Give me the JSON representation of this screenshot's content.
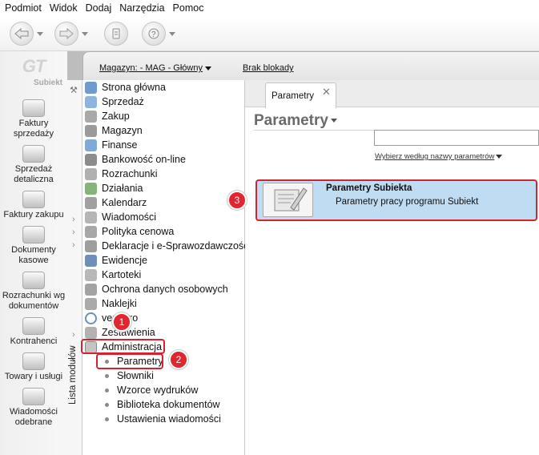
{
  "menu": [
    "Podmiot",
    "Widok",
    "Dodaj",
    "Narzędzia",
    "Pomoc"
  ],
  "toolbar": {
    "buttons": [
      "back-icon",
      "forward-icon",
      "module-icon",
      "help-icon"
    ]
  },
  "logo": {
    "mark": "GT",
    "text": "Subiekt"
  },
  "left_nav": [
    {
      "label": "Faktury sprzedaży",
      "icon": "invoice-icon"
    },
    {
      "label": "Sprzedaż detaliczna",
      "icon": "cash-register-icon"
    },
    {
      "label": "Faktury zakupu",
      "icon": "purchase-invoice-icon"
    },
    {
      "label": "Dokumenty kasowe",
      "icon": "cash-documents-icon"
    },
    {
      "label": "Rozrachunki wg dokumentów",
      "icon": "settlements-icon"
    },
    {
      "label": "Kontrahenci",
      "icon": "contractors-icon"
    },
    {
      "label": "Towary i usługi",
      "icon": "goods-icon"
    },
    {
      "label": "Wiadomości odebrane",
      "icon": "messages-icon"
    }
  ],
  "topbar": {
    "magazyn": "Magazyn: - MAG - Główny",
    "blokada": "Brak blokady"
  },
  "module_list_label": "Lista modułów",
  "tree": [
    {
      "label": "Strona główna",
      "icon": "home-icon"
    },
    {
      "label": "Sprzedaż",
      "icon": "sales-icon"
    },
    {
      "label": "Zakup",
      "icon": "purchase-icon"
    },
    {
      "label": "Magazyn",
      "icon": "warehouse-icon"
    },
    {
      "label": "Finanse",
      "icon": "finance-icon"
    },
    {
      "label": "Bankowość on-line",
      "icon": "bank-icon"
    },
    {
      "label": "Rozrachunki",
      "icon": "settlement-icon"
    },
    {
      "label": "Działania",
      "icon": "actions-icon"
    },
    {
      "label": "Kalendarz",
      "icon": "calendar-icon"
    },
    {
      "label": "Wiadomości",
      "icon": "message-icon"
    },
    {
      "label": "Polityka cenowa",
      "icon": "pricing-icon"
    },
    {
      "label": "Deklaracje i e-Sprawozdawczość",
      "icon": "declaration-icon"
    },
    {
      "label": "Ewidencje",
      "icon": "records-icon"
    },
    {
      "label": "Kartoteki",
      "icon": "files-icon"
    },
    {
      "label": "Ochrona danych osobowych",
      "icon": "privacy-icon"
    },
    {
      "label": "Naklejki",
      "icon": "stickers-icon"
    },
    {
      "label": "vendero",
      "icon": "vendero-icon"
    },
    {
      "label": "Zestawienia",
      "icon": "reports-icon"
    },
    {
      "label": "Administracja",
      "icon": "admin-icon"
    }
  ],
  "admin_children": [
    "Parametry",
    "Słowniki",
    "Wzorce wydruków",
    "Biblioteka dokumentów",
    "Ustawienia wiadomości"
  ],
  "tab": {
    "label": "Parametry"
  },
  "page": {
    "title": "Parametry",
    "search_value": "",
    "pick_link": "Wybierz według nazwy parametrów"
  },
  "card": {
    "title": "Parametry Subiekta",
    "desc": "Parametry pracy programu Subiekt"
  },
  "badges": [
    "1",
    "2",
    "3"
  ],
  "colors": {
    "highlight": "#d3232f",
    "badge": "#e0262f",
    "card_bg": "#bfdcf3"
  }
}
